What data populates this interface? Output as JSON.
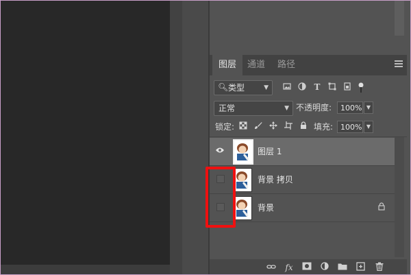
{
  "layers_panel": {
    "tabs": [
      {
        "label": "图层",
        "active": true
      },
      {
        "label": "通道",
        "active": false
      },
      {
        "label": "路径",
        "active": false
      }
    ],
    "filter": {
      "label": "类型"
    },
    "blend_mode": "正常",
    "opacity_label": "不透明度:",
    "opacity_value": "100%",
    "lock_label": "锁定:",
    "fill_label": "填充:",
    "fill_value": "100%",
    "layers": [
      {
        "name": "图层 1",
        "visible": true,
        "selected": true,
        "locked": false
      },
      {
        "name": "背景 拷贝",
        "visible": false,
        "selected": false,
        "locked": false
      },
      {
        "name": "背景",
        "visible": false,
        "selected": false,
        "locked": true
      }
    ]
  },
  "colors": {
    "highlight": "#f01010",
    "panel_bg": "#535353",
    "canvas_bg": "#282828",
    "selected_layer": "#6b6b6b"
  },
  "icons": {
    "filter": [
      "image-filter-icon",
      "adjustment-filter-icon",
      "text-filter-icon",
      "shape-filter-icon",
      "smart-object-filter-icon",
      "filter-toggle-icon"
    ],
    "lock": [
      "lock-pixels-icon",
      "lock-paint-icon",
      "lock-move-icon",
      "lock-artboard-icon",
      "lock-all-icon"
    ],
    "bottom": [
      "link-layers-icon",
      "fx-icon",
      "add-mask-icon",
      "adjustment-layer-icon",
      "new-group-icon",
      "new-layer-icon",
      "trash-icon"
    ]
  }
}
